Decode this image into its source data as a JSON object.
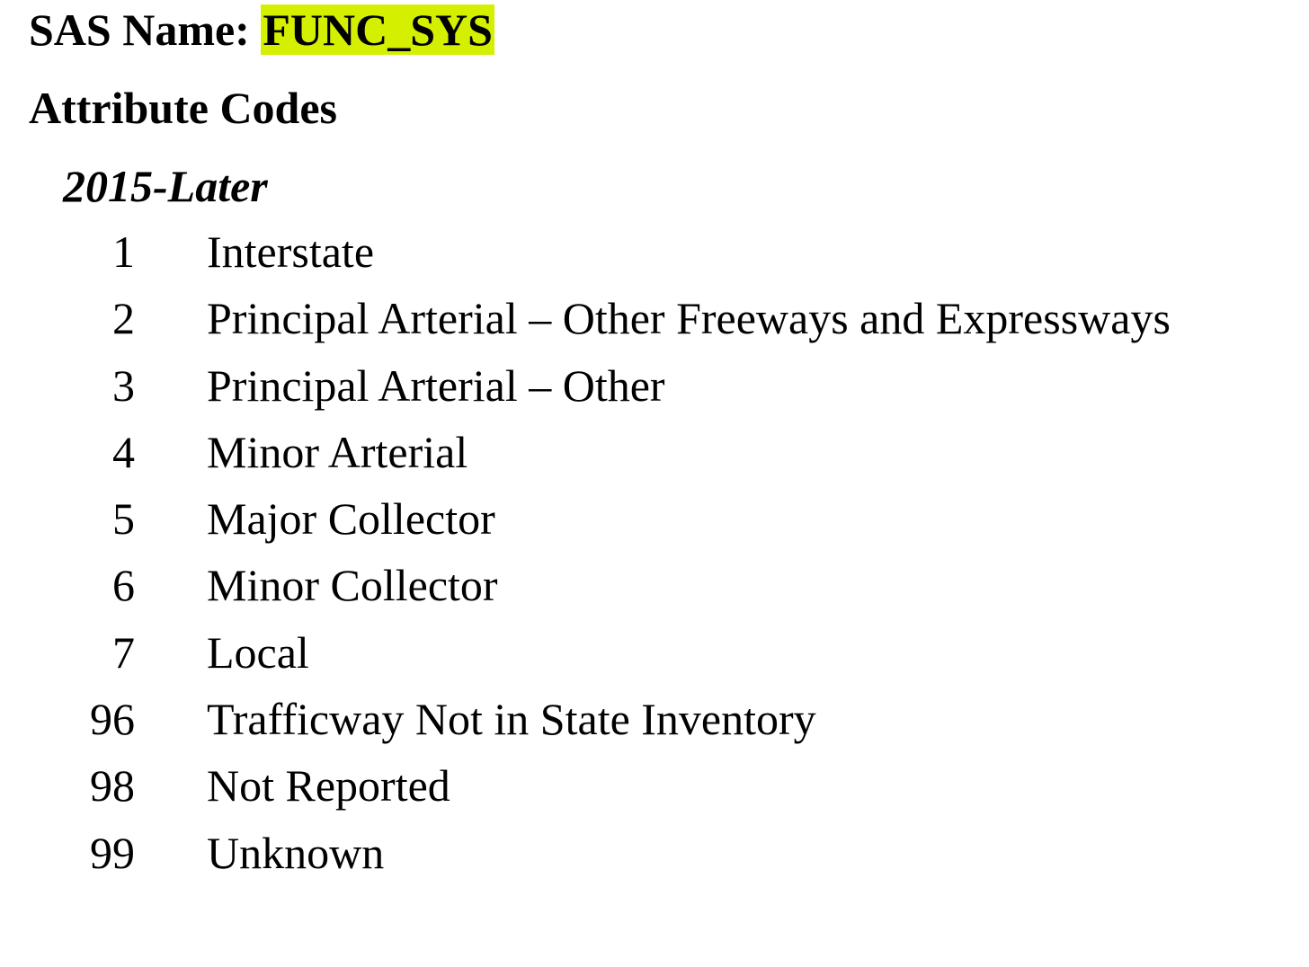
{
  "header": {
    "sas_name_label": "SAS Name:",
    "sas_name_value": "FUNC_SYS",
    "highlight_color": "#d4f000"
  },
  "section": {
    "title": "Attribute Codes",
    "period": "2015-Later"
  },
  "codes": [
    {
      "code": "1",
      "label": "Interstate"
    },
    {
      "code": "2",
      "label": "Principal Arterial – Other Freeways and Expressways"
    },
    {
      "code": "3",
      "label": "Principal Arterial – Other"
    },
    {
      "code": "4",
      "label": "Minor Arterial"
    },
    {
      "code": "5",
      "label": "Major Collector"
    },
    {
      "code": "6",
      "label": "Minor Collector"
    },
    {
      "code": "7",
      "label": "Local"
    },
    {
      "code": "96",
      "label": "Trafficway Not in State Inventory"
    },
    {
      "code": "98",
      "label": "Not Reported"
    },
    {
      "code": "99",
      "label": "Unknown"
    }
  ]
}
